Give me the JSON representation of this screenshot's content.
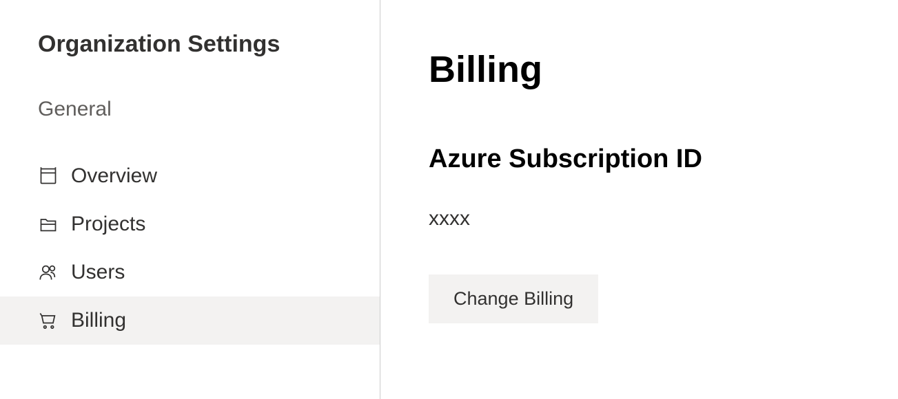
{
  "sidebar": {
    "title": "Organization Settings",
    "section_label": "General",
    "items": [
      {
        "label": "Overview",
        "icon": "overview-icon",
        "active": false
      },
      {
        "label": "Projects",
        "icon": "folder-icon",
        "active": false
      },
      {
        "label": "Users",
        "icon": "users-icon",
        "active": false
      },
      {
        "label": "Billing",
        "icon": "cart-icon",
        "active": true
      }
    ]
  },
  "main": {
    "title": "Billing",
    "subscription_label": "Azure Subscription ID",
    "subscription_value": "xxxx",
    "change_button_label": "Change Billing"
  }
}
